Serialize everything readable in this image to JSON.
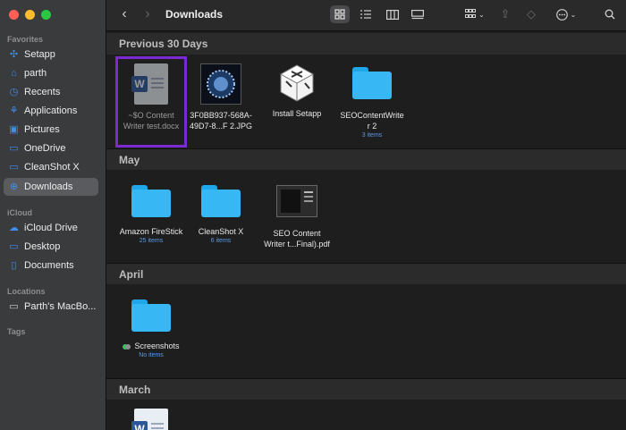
{
  "window": {
    "title": "Downloads",
    "traffic_colors": [
      "#ff5f57",
      "#febc2e",
      "#28c840"
    ]
  },
  "sidebar": {
    "favorites_label": "Favorites",
    "favorites": [
      {
        "label": "Setapp",
        "icon": "setapp-icon"
      },
      {
        "label": "parth",
        "icon": "home-icon"
      },
      {
        "label": "Recents",
        "icon": "clock-icon"
      },
      {
        "label": "Applications",
        "icon": "applications-icon"
      },
      {
        "label": "Pictures",
        "icon": "pictures-icon"
      },
      {
        "label": "OneDrive",
        "icon": "folder-icon"
      },
      {
        "label": "CleanShot X",
        "icon": "folder-icon"
      },
      {
        "label": "Downloads",
        "icon": "download-icon",
        "selected": true
      }
    ],
    "icloud_label": "iCloud",
    "icloud": [
      {
        "label": "iCloud Drive",
        "icon": "cloud-icon"
      },
      {
        "label": "Desktop",
        "icon": "desktop-icon"
      },
      {
        "label": "Documents",
        "icon": "document-icon"
      }
    ],
    "locations_label": "Locations",
    "locations": [
      {
        "label": "Parth's MacBo...",
        "icon": "laptop-icon"
      }
    ],
    "tags_label": "Tags"
  },
  "groups": [
    {
      "label": "Previous 30 Days",
      "items": [
        {
          "name_line1": "~$O Content",
          "name_line2": "Writer test.docx",
          "kind": "word-doc",
          "selected": true
        },
        {
          "name_line1": "3F0BB937-568A-",
          "name_line2": "49D7-8...F 2.JPG",
          "kind": "image"
        },
        {
          "name_line1": "Install Setapp",
          "name_line2": "",
          "kind": "app"
        },
        {
          "name_line1": "SEOContentWrite",
          "name_line2": "r 2",
          "kind": "folder",
          "sub": "3 items"
        }
      ]
    },
    {
      "label": "May",
      "items": [
        {
          "name_line1": "Amazon FireStick",
          "name_line2": "",
          "kind": "folder",
          "sub": "25 items"
        },
        {
          "name_line1": "CleanShot X",
          "name_line2": "",
          "kind": "folder",
          "sub": "6 items"
        },
        {
          "name_line1": "SEO Content",
          "name_line2": "Writer t...Final).pdf",
          "kind": "pdf"
        }
      ]
    },
    {
      "label": "April",
      "items": [
        {
          "name_line1": "Screenshots",
          "name_line2": "",
          "kind": "folder",
          "sub": "No items",
          "tag_colors": [
            "#34c759",
            "#8e8e93"
          ]
        }
      ]
    },
    {
      "label": "March",
      "items": [
        {
          "kind": "word-doc"
        }
      ]
    }
  ]
}
